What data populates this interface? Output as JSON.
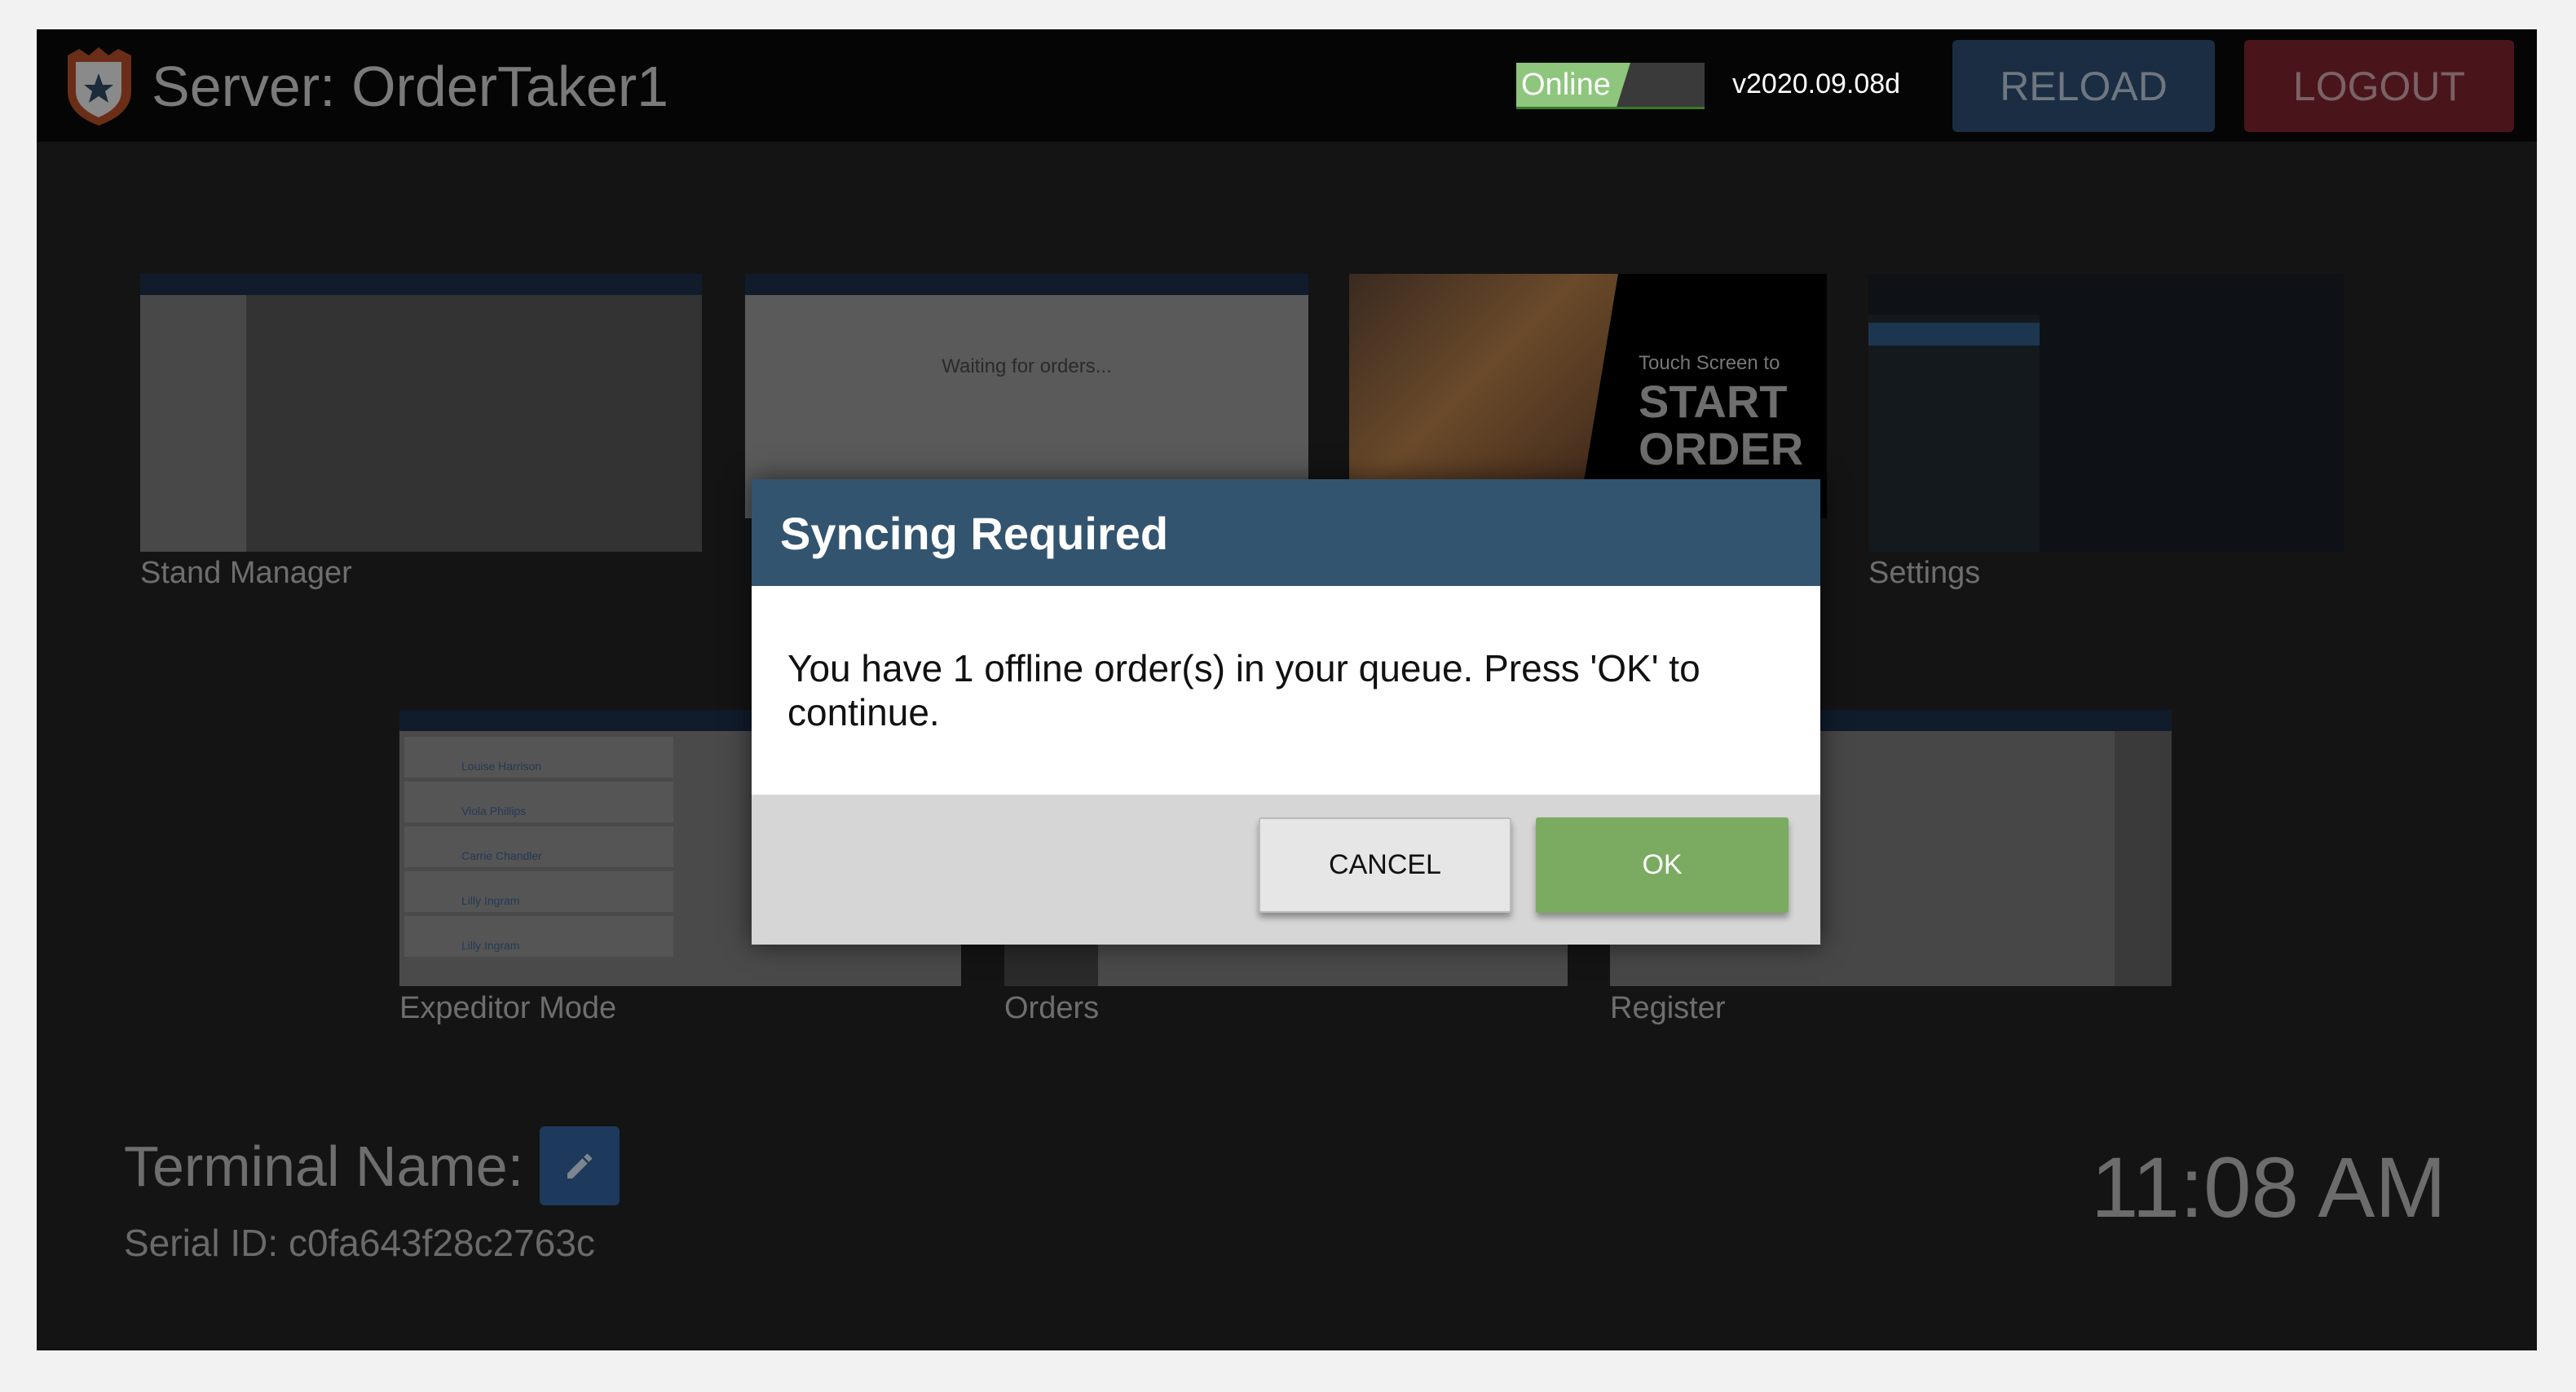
{
  "header": {
    "title": "Server: OrderTaker1",
    "status": "Online",
    "version": "v2020.09.08d",
    "reload_label": "RELOAD",
    "logout_label": "LOGOUT"
  },
  "apps": [
    {
      "label": "Stand Manager"
    },
    {
      "label": "",
      "thumb_text": "Waiting for orders..."
    },
    {
      "label": "",
      "thumb_text_small": "Touch Screen to",
      "thumb_text_big": "START ORDER"
    },
    {
      "label": "Settings"
    },
    {
      "label": "Expeditor Mode",
      "thumb_names": [
        "Louise Harrison",
        "Viola Phillips",
        "Carrie Chandler",
        "Lilly Ingram",
        "Lilly Ingram"
      ]
    },
    {
      "label": "Orders"
    },
    {
      "label": "Register"
    }
  ],
  "terminal": {
    "name_label": "Terminal Name:",
    "serial": "Serial ID: c0fa643f28c2763c",
    "time": "11:08 AM"
  },
  "dialog": {
    "title": "Syncing Required",
    "message": "You have 1 offline order(s) in your queue. Press 'OK' to continue.",
    "cancel_label": "CANCEL",
    "ok_label": "OK"
  },
  "colors": {
    "dialog_header": "#32546f",
    "ok": "#7aab61",
    "online": "#8dc67c"
  }
}
